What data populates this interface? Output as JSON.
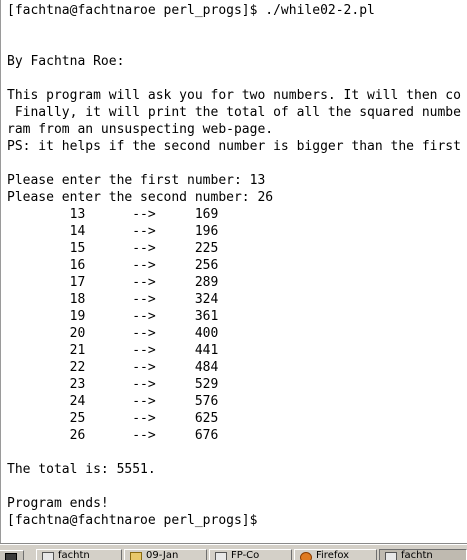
{
  "terminal": {
    "lines": [
      "[fachtna@fachtnaroe perl_progs]$ ./while02-2.pl",
      "",
      "",
      "By Fachtna Roe:",
      "",
      "This program will ask you for two numbers. It will then co",
      " Finally, it will print the total of all the squared numbe",
      "ram from an unsuspecting web-page.",
      "PS: it helps if the second number is bigger than the first",
      "",
      "Please enter the first number: 13",
      "Please enter the second number: 26",
      "        13      -->     169",
      "        14      -->     196",
      "        15      -->     225",
      "        16      -->     256",
      "        17      -->     289",
      "        18      -->     324",
      "        19      -->     361",
      "        20      -->     400",
      "        21      -->     441",
      "        22      -->     484",
      "        23      -->     529",
      "        24      -->     576",
      "        25      -->     625",
      "        26      -->     676",
      "",
      "The total is: 5551.",
      "",
      "Program ends!",
      "[fachtna@fachtnaroe perl_progs]$"
    ]
  },
  "taskbar": {
    "start_icon": "terminal-icon",
    "buttons": [
      {
        "label": "fachtn",
        "icon": "terminal-icon",
        "active": false
      },
      {
        "label": "09-Jan",
        "icon": "folder-icon",
        "active": false
      },
      {
        "label": "FP-Co",
        "icon": "document-icon",
        "active": false
      },
      {
        "label": "Firefox",
        "icon": "firefox-icon",
        "active": false
      },
      {
        "label": "fachtn",
        "icon": "terminal-icon",
        "active": true
      }
    ]
  }
}
